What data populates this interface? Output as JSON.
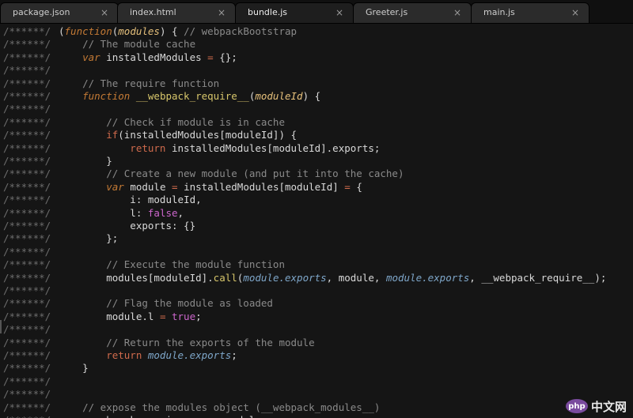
{
  "tabs": [
    {
      "label": "package.json",
      "close": "×"
    },
    {
      "label": "index.html",
      "close": "×"
    },
    {
      "label": "bundle.js",
      "close": "×",
      "active": true
    },
    {
      "label": "Greeter.js",
      "close": "×"
    },
    {
      "label": "main.js",
      "close": "×"
    }
  ],
  "gutter_prefix": "/******/",
  "lines": [
    [
      [
        "o",
        "("
      ],
      [
        "k",
        "function"
      ],
      [
        "o",
        "("
      ],
      [
        "p",
        "modules"
      ],
      [
        "o",
        ") { "
      ],
      [
        "c",
        "// webpackBootstrap"
      ]
    ],
    [
      [
        "c",
        "    // The module cache"
      ]
    ],
    [
      [
        "k",
        "    var"
      ],
      [
        "o",
        " installedModules "
      ],
      [
        "r",
        "="
      ],
      [
        "o",
        " {};"
      ]
    ],
    [],
    [
      [
        "c",
        "    // The require function"
      ]
    ],
    [
      [
        "k",
        "    function"
      ],
      [
        "fn",
        " __webpack_require__"
      ],
      [
        "o",
        "("
      ],
      [
        "p",
        "moduleId"
      ],
      [
        "o",
        ") {"
      ]
    ],
    [],
    [
      [
        "c",
        "        // Check if module is in cache"
      ]
    ],
    [
      [
        "r",
        "        if"
      ],
      [
        "o",
        "(installedModules[moduleId]) {"
      ]
    ],
    [
      [
        "r",
        "            return"
      ],
      [
        "o",
        " installedModules[moduleId].exports;"
      ]
    ],
    [
      [
        "o",
        "        }"
      ]
    ],
    [
      [
        "c",
        "        // Create a new module (and put it into the cache)"
      ]
    ],
    [
      [
        "k",
        "        var"
      ],
      [
        "o",
        " module "
      ],
      [
        "r",
        "="
      ],
      [
        "o",
        " installedModules[moduleId] "
      ],
      [
        "r",
        "="
      ],
      [
        "o",
        " {"
      ]
    ],
    [
      [
        "o",
        "            i: moduleId,"
      ]
    ],
    [
      [
        "o",
        "            l: "
      ],
      [
        "t",
        "false"
      ],
      [
        "o",
        ","
      ]
    ],
    [
      [
        "o",
        "            exports: {}"
      ]
    ],
    [
      [
        "o",
        "        };"
      ]
    ],
    [],
    [
      [
        "c",
        "        // Execute the module function"
      ]
    ],
    [
      [
        "o",
        "        modules[moduleId]."
      ],
      [
        "fn",
        "call"
      ],
      [
        "o",
        "("
      ],
      [
        "ml",
        "module.exports"
      ],
      [
        "o",
        ", module, "
      ],
      [
        "ml",
        "module.exports"
      ],
      [
        "o",
        ", __webpack_require__);"
      ]
    ],
    [],
    [
      [
        "c",
        "        // Flag the module as loaded"
      ]
    ],
    [
      [
        "o",
        "        module.l "
      ],
      [
        "r",
        "="
      ],
      [
        "t",
        " true"
      ],
      [
        "o",
        ";"
      ]
    ],
    [],
    [
      [
        "c",
        "        // Return the exports of the module"
      ]
    ],
    [
      [
        "r",
        "        return"
      ],
      [
        "ml",
        " module.exports"
      ],
      [
        "o",
        ";"
      ]
    ],
    [
      [
        "o",
        "    }"
      ]
    ],
    [],
    [],
    [
      [
        "c",
        "    // expose the modules object (__webpack_modules__)"
      ]
    ],
    [
      [
        "o",
        "    __webpack_require__.m "
      ],
      [
        "r",
        "="
      ],
      [
        "o",
        " modules;"
      ]
    ]
  ],
  "watermark": {
    "logo": "php",
    "text": "中文网"
  }
}
